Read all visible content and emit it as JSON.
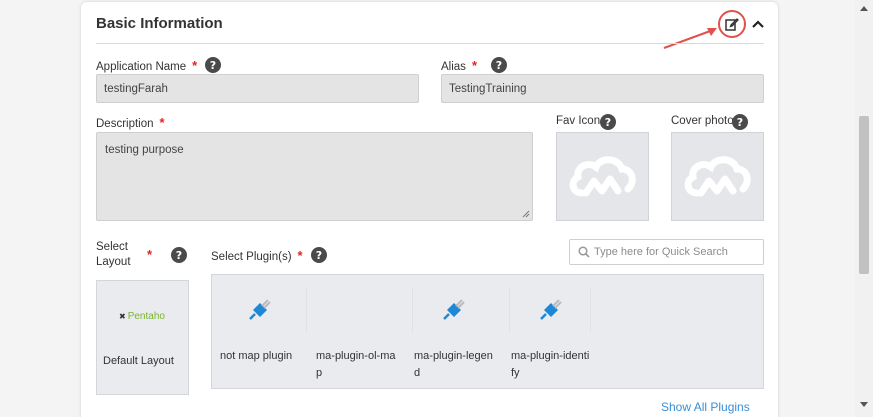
{
  "section": {
    "title": "Basic Information",
    "edit_icon": "edit-icon",
    "collapse_icon": "chevron-up-icon",
    "highlight_color": "#e0524d"
  },
  "fields": {
    "app_name": {
      "label": "Application Name",
      "required": "*",
      "value": "testingFarah"
    },
    "alias": {
      "label": "Alias",
      "required": "*",
      "value": "TestingTraining"
    },
    "description": {
      "label": "Description",
      "required": "*",
      "value": "testing purpose"
    },
    "fav_icon": {
      "label": "Fav Icon"
    },
    "cover_photo": {
      "label": "Cover photo"
    },
    "select_layout": {
      "label_line1": "Select",
      "label_line2": "Layout",
      "required": "*"
    },
    "select_plugins": {
      "label": "Select Plugin(s)",
      "required": "*"
    }
  },
  "help_glyph": "?",
  "search": {
    "placeholder": "Type here for Quick Search"
  },
  "layout": {
    "logo_text": "Pentaho",
    "name": "Default Layout"
  },
  "plugins": [
    {
      "name": "not map plugin"
    },
    {
      "name": "ma-plugin-ol-map"
    },
    {
      "name": "ma-plugin-legend"
    },
    {
      "name": "ma-plugin-identify"
    }
  ],
  "show_all": "Show All Plugins",
  "colors": {
    "accent_blue": "#1e88d6",
    "link": "#3b8ed6",
    "required": "#e02424"
  }
}
